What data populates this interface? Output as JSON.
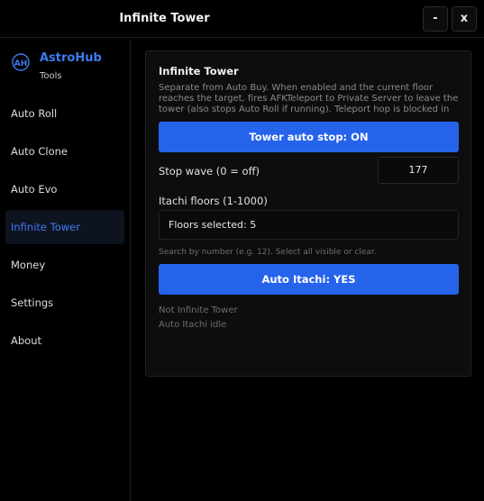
{
  "window": {
    "title": "Infinite Tower",
    "minimize_label": "-",
    "close_label": "x"
  },
  "brand": {
    "logo_text": "AH",
    "name": "AstroHub",
    "subtitle": "Tools"
  },
  "sidebar": {
    "items": [
      {
        "label": "Auto Roll",
        "active": false
      },
      {
        "label": "Auto Clone",
        "active": false
      },
      {
        "label": "Auto Evo",
        "active": false
      },
      {
        "label": "Infinite Tower",
        "active": true
      },
      {
        "label": "Money",
        "active": false
      },
      {
        "label": "Settings",
        "active": false
      },
      {
        "label": "About",
        "active": false
      }
    ]
  },
  "panel": {
    "title": "Infinite Tower",
    "description": "Separate from Auto Buy. When enabled and the current floor reaches the target, fires AFKTeleport to Private Server to leave the tower (also stops Auto Roll if running). Teleport hop is blocked in",
    "tower_stop_button": "Tower auto stop: ON",
    "stop_wave_label": "Stop wave (0 = off)",
    "stop_wave_value": "177",
    "itachi_floors_label": "Itachi floors (1-1000)",
    "floors_selected": "Floors selected: 5",
    "hint": "Search by number (e.g. 12). Select all visible or clear.",
    "auto_itachi_button": "Auto Itachi: YES",
    "status_line_1": "Not Infinite Tower",
    "status_line_2": "Auto Itachi idle"
  },
  "colors": {
    "accent": "#3d7bf0",
    "button": "#2563eb",
    "background": "#000000",
    "panel": "#0d0d0f"
  }
}
